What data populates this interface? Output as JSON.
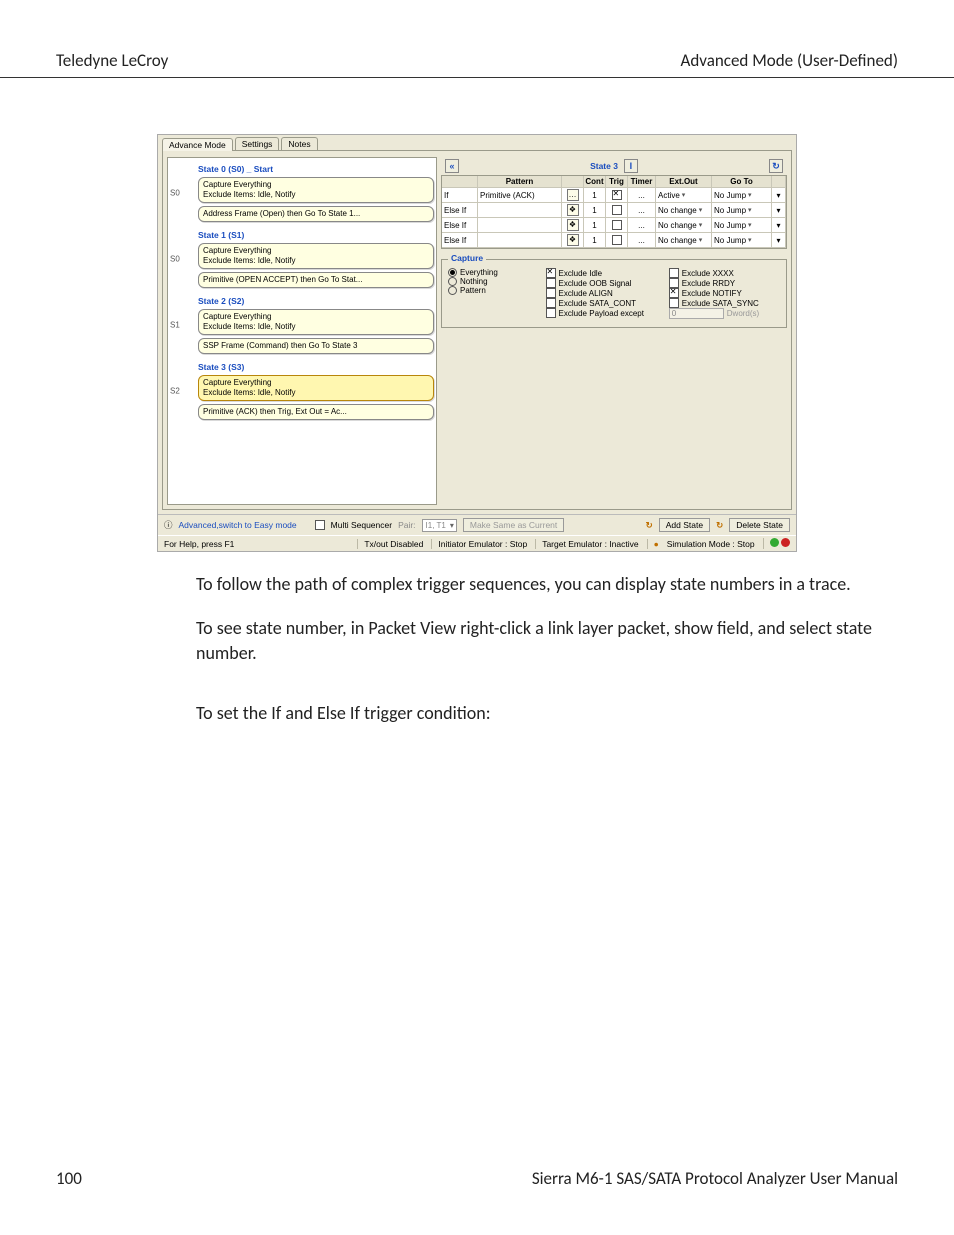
{
  "header": {
    "left": "Teledyne LeCroy",
    "right": "Advanced Mode (User-Defined)"
  },
  "footer": {
    "page": "100",
    "manual": "Sierra M6-1 SAS/SATA Protocol Analyzer User Manual"
  },
  "paragraphs": {
    "p1": "To follow the path of complex trigger sequences, you can display state numbers in a trace.",
    "p2": "To see state number, in Packet View right-click a link layer packet, show field, and select state number.",
    "p3": "To set the If and Else If trigger condition:"
  },
  "shot": {
    "tabs": [
      "Advance Mode",
      "Settings",
      "Notes"
    ],
    "left": {
      "states": [
        {
          "side": "S0",
          "title": "State 0 (S0) _ Start",
          "cards": [
            {
              "lines": [
                "Capture Everything",
                "Exclude Items: Idle, Notify"
              ]
            },
            {
              "lines": [
                "Address Frame (Open) then Go To State 1..."
              ]
            }
          ]
        },
        {
          "side": "S0",
          "title": "State 1 (S1)",
          "cards": [
            {
              "lines": [
                "Capture Everything",
                "Exclude Items: Idle, Notify"
              ]
            },
            {
              "lines": [
                "Primitive (OPEN ACCEPT) then Go To Stat..."
              ]
            }
          ]
        },
        {
          "side": "S1",
          "title": "State 2 (S2)",
          "cards": [
            {
              "lines": [
                "Capture Everything",
                "Exclude Items: Idle, Notify"
              ]
            },
            {
              "lines": [
                "SSP Frame (Command) then Go To State 3"
              ]
            }
          ]
        },
        {
          "side": "S2",
          "title": "State 3 (S3)",
          "selected": true,
          "cards": [
            {
              "lines": [
                "Capture Everything",
                "Exclude Items: Idle, Notify"
              ],
              "selected": true
            },
            {
              "lines": [
                "Primitive (ACK) then Trig, Ext Out = Ac..."
              ]
            }
          ]
        }
      ]
    },
    "right": {
      "title": "State 3",
      "table": {
        "head": {
          "c0": "",
          "c1": "Pattern",
          "c2": "Cont",
          "c3": "Trig",
          "c4": "Timer",
          "c5": "Ext.Out",
          "c6": "Go To"
        },
        "rows": [
          {
            "op": "If",
            "pattern": "Primitive (ACK)",
            "cont": "1",
            "trig": true,
            "timer": "...",
            "extout": "Active",
            "goto": "No Jump"
          },
          {
            "op": "Else If",
            "pattern": "",
            "cont": "1",
            "trig": false,
            "timer": "...",
            "extout": "No change",
            "goto": "No Jump"
          },
          {
            "op": "Else If",
            "pattern": "",
            "cont": "1",
            "trig": false,
            "timer": "...",
            "extout": "No change",
            "goto": "No Jump"
          },
          {
            "op": "Else If",
            "pattern": "",
            "cont": "1",
            "trig": false,
            "timer": "...",
            "extout": "No change",
            "goto": "No Jump"
          }
        ]
      },
      "capture": {
        "title": "Capture",
        "radios": {
          "everything": "Everything",
          "nothing": "Nothing",
          "pattern": "Pattern",
          "selected": "everything"
        },
        "col2": [
          {
            "label": "Exclude Idle",
            "checked": true
          },
          {
            "label": "Exclude OOB Signal",
            "checked": false
          },
          {
            "label": "Exclude ALIGN",
            "checked": false
          },
          {
            "label": "Exclude SATA_CONT",
            "checked": false
          },
          {
            "label": "Exclude Payload except",
            "checked": false
          }
        ],
        "col3": [
          {
            "label": "Exclude XXXX",
            "checked": false
          },
          {
            "label": "Exclude RRDY",
            "checked": false
          },
          {
            "label": "Exclude NOTIFY",
            "checked": true
          },
          {
            "label": "Exclude SATA_SYNC",
            "checked": false
          }
        ],
        "dword_value": "0",
        "dword_hint": "Dword(s)"
      }
    },
    "bottombar": {
      "switch_link": "Advanced,switch to Easy mode",
      "multi_seq": "Multi Sequencer",
      "pair_label": "Pair:",
      "pair_value": "I1, T1",
      "make_same": "Make Same as Current",
      "add_state": "Add State",
      "delete_state": "Delete State"
    },
    "statusbar": {
      "help": "For Help, press F1",
      "tx": "Tx/out Disabled",
      "init": "Initiator Emulator : Stop",
      "target": "Target Emulator : Inactive",
      "sim": "Simulation Mode : Stop"
    }
  }
}
